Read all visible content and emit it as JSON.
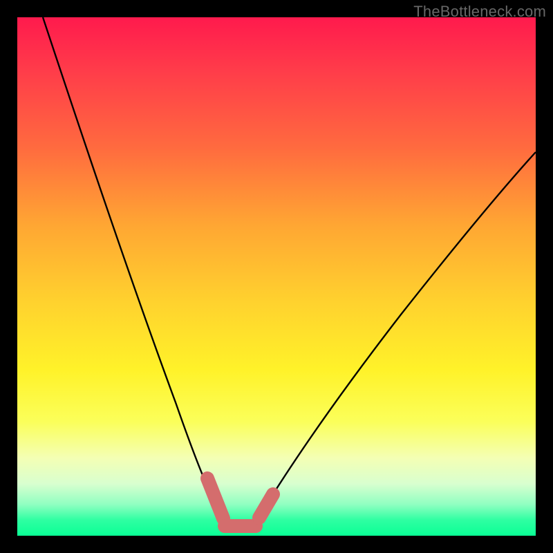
{
  "watermark": "TheBottleneck.com",
  "chart_data": {
    "type": "line",
    "title": "",
    "xlabel": "",
    "ylabel": "",
    "xlim": [
      0,
      100
    ],
    "ylim": [
      0,
      100
    ],
    "grid": false,
    "legend": false,
    "series": [
      {
        "name": "curve",
        "x": [
          5,
          10,
          15,
          20,
          25,
          30,
          33,
          36,
          38,
          40,
          42,
          44,
          46,
          50,
          55,
          60,
          65,
          70,
          75,
          80,
          85,
          90,
          95,
          100
        ],
        "y": [
          100,
          84,
          68,
          53,
          39,
          26,
          17,
          10,
          6,
          3,
          2,
          2,
          2,
          3,
          6,
          11,
          18,
          25,
          33,
          41,
          49,
          57,
          64,
          71
        ]
      }
    ],
    "markers": {
      "left_capsule": {
        "approx_x_range": [
          36,
          39
        ],
        "approx_y_range": [
          4,
          11
        ]
      },
      "bottom_capsule": {
        "approx_x_range": [
          39,
          46
        ],
        "approx_y_range": [
          2,
          2
        ]
      },
      "right_capsule": {
        "approx_x_range": [
          46,
          49
        ],
        "approx_y_range": [
          2,
          7
        ]
      }
    },
    "colors": {
      "curve": "#000000",
      "markers": "#d46d6d",
      "gradient_top": "#ff1a4d",
      "gradient_bottom": "#0aff95",
      "frame": "#000000"
    }
  }
}
